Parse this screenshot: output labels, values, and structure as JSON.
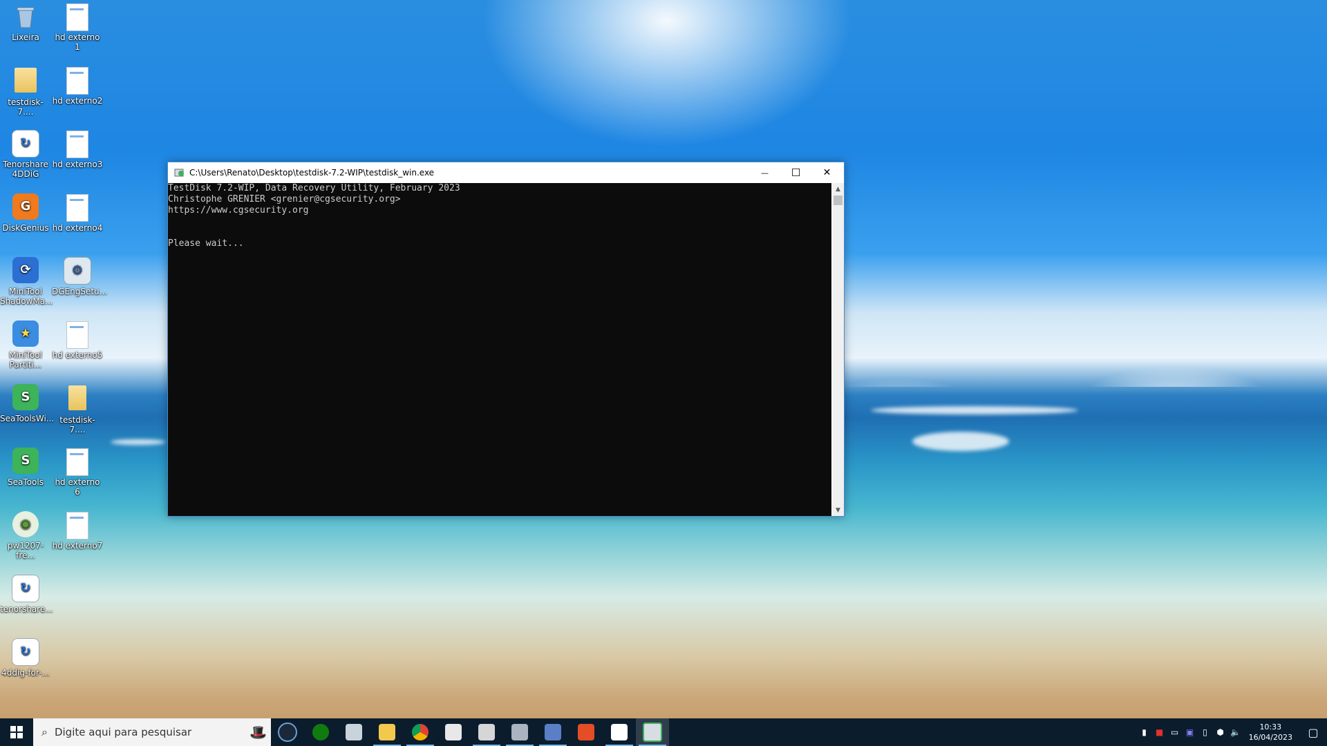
{
  "desktop": {
    "icons_col1": [
      {
        "label": "Lixeira",
        "icon": "recycle-bin-icon"
      },
      {
        "label": "testdisk-7....",
        "icon": "folder-icon"
      },
      {
        "label": "Tenorshare 4DDiG",
        "icon": "tenorshare-icon"
      },
      {
        "label": "DiskGenius",
        "icon": "diskgenius-icon"
      },
      {
        "label": "MiniTool ShadowMa...",
        "icon": "minitool-shadowmaker-icon"
      },
      {
        "label": "MiniTool Partiti...",
        "icon": "minitool-partition-icon"
      },
      {
        "label": "SeaToolsWi...",
        "icon": "seatools-icon"
      },
      {
        "label": "SeaTools",
        "icon": "seatools-icon"
      },
      {
        "label": "pw1207-fre...",
        "icon": "installer-icon"
      },
      {
        "label": "tenorshare...",
        "icon": "tenorshare-icon"
      },
      {
        "label": "4ddig-for-...",
        "icon": "tenorshare-icon"
      }
    ],
    "icons_col2": [
      {
        "label": "hd externo 1",
        "icon": "document-icon"
      },
      {
        "label": "hd externo2",
        "icon": "document-icon"
      },
      {
        "label": "hd externo3",
        "icon": "document-icon"
      },
      {
        "label": "hd externo4",
        "icon": "document-icon"
      },
      {
        "label": "DGEngSetu...",
        "icon": "setup-icon"
      },
      {
        "label": "hd externo5",
        "icon": "document-icon"
      },
      {
        "label": "testdisk-7....",
        "icon": "zip-folder-icon"
      },
      {
        "label": "hd externo 6",
        "icon": "document-icon"
      },
      {
        "label": "hd externo7",
        "icon": "document-icon"
      }
    ]
  },
  "console_window": {
    "title": "C:\\Users\\Renato\\Desktop\\testdisk-7.2-WIP\\testdisk_win.exe",
    "lines": [
      "TestDisk 7.2-WIP, Data Recovery Utility, February 2023",
      "Christophe GRENIER <grenier@cgsecurity.org>",
      "https://www.cgsecurity.org",
      "",
      "",
      "Please wait..."
    ],
    "minimize_glyph": "—",
    "maximize_glyph": "☐",
    "close_glyph": "✕"
  },
  "taskbar": {
    "search_placeholder": "Digite aqui para pesquisar",
    "apps": [
      "steam-icon",
      "xbox-icon",
      "printer-icon",
      "file-explorer-icon",
      "chrome-icon",
      "video-editor-icon",
      "archive-icon",
      "installer-icon",
      "network-icon",
      "html5-icon",
      "tenorshare-icon",
      "testdisk-icon"
    ],
    "clock_time": "10:33",
    "clock_date": "16/04/2023"
  },
  "colors": {
    "taskbar": "#0b1d2d",
    "console_bg": "#0c0c0c",
    "console_text": "#cccccc",
    "window_border": "#4b8bd1"
  }
}
